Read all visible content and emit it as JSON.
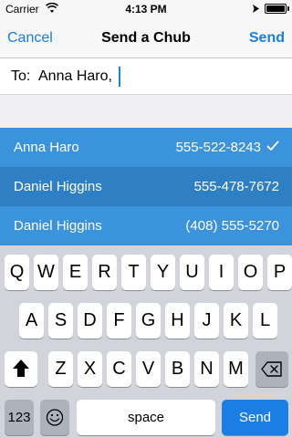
{
  "status_bar": {
    "carrier": "Carrier",
    "time": "4:13 PM",
    "icons": [
      "wifi-icon",
      "location-arrow-icon",
      "battery-icon"
    ]
  },
  "nav": {
    "cancel_label": "Cancel",
    "title": "Send a Chub",
    "send_label": "Send"
  },
  "to_field": {
    "label": "To:",
    "value": "Anna Haro,"
  },
  "suggestions": [
    {
      "name": "Anna Haro",
      "phone": "555-522-8243",
      "selected": true
    },
    {
      "name": "Daniel Higgins",
      "phone": "555-478-7672",
      "selected": false
    },
    {
      "name": "Daniel Higgins",
      "phone": "(408) 555-5270",
      "selected": false
    }
  ],
  "keyboard": {
    "row1": [
      "Q",
      "W",
      "E",
      "R",
      "T",
      "Y",
      "U",
      "I",
      "O",
      "P"
    ],
    "row2": [
      "A",
      "S",
      "D",
      "F",
      "G",
      "H",
      "J",
      "K",
      "L"
    ],
    "row3": [
      "Z",
      "X",
      "C",
      "V",
      "B",
      "N",
      "M"
    ],
    "numbers_label": "123",
    "space_label": "space",
    "send_label": "Send"
  },
  "colors": {
    "accent": "#1a7ee5",
    "suggestion_bg": "#3b93dc",
    "suggestion_bg_alt": "#2e7fc4",
    "keyboard_bg": "#d1d5db"
  }
}
